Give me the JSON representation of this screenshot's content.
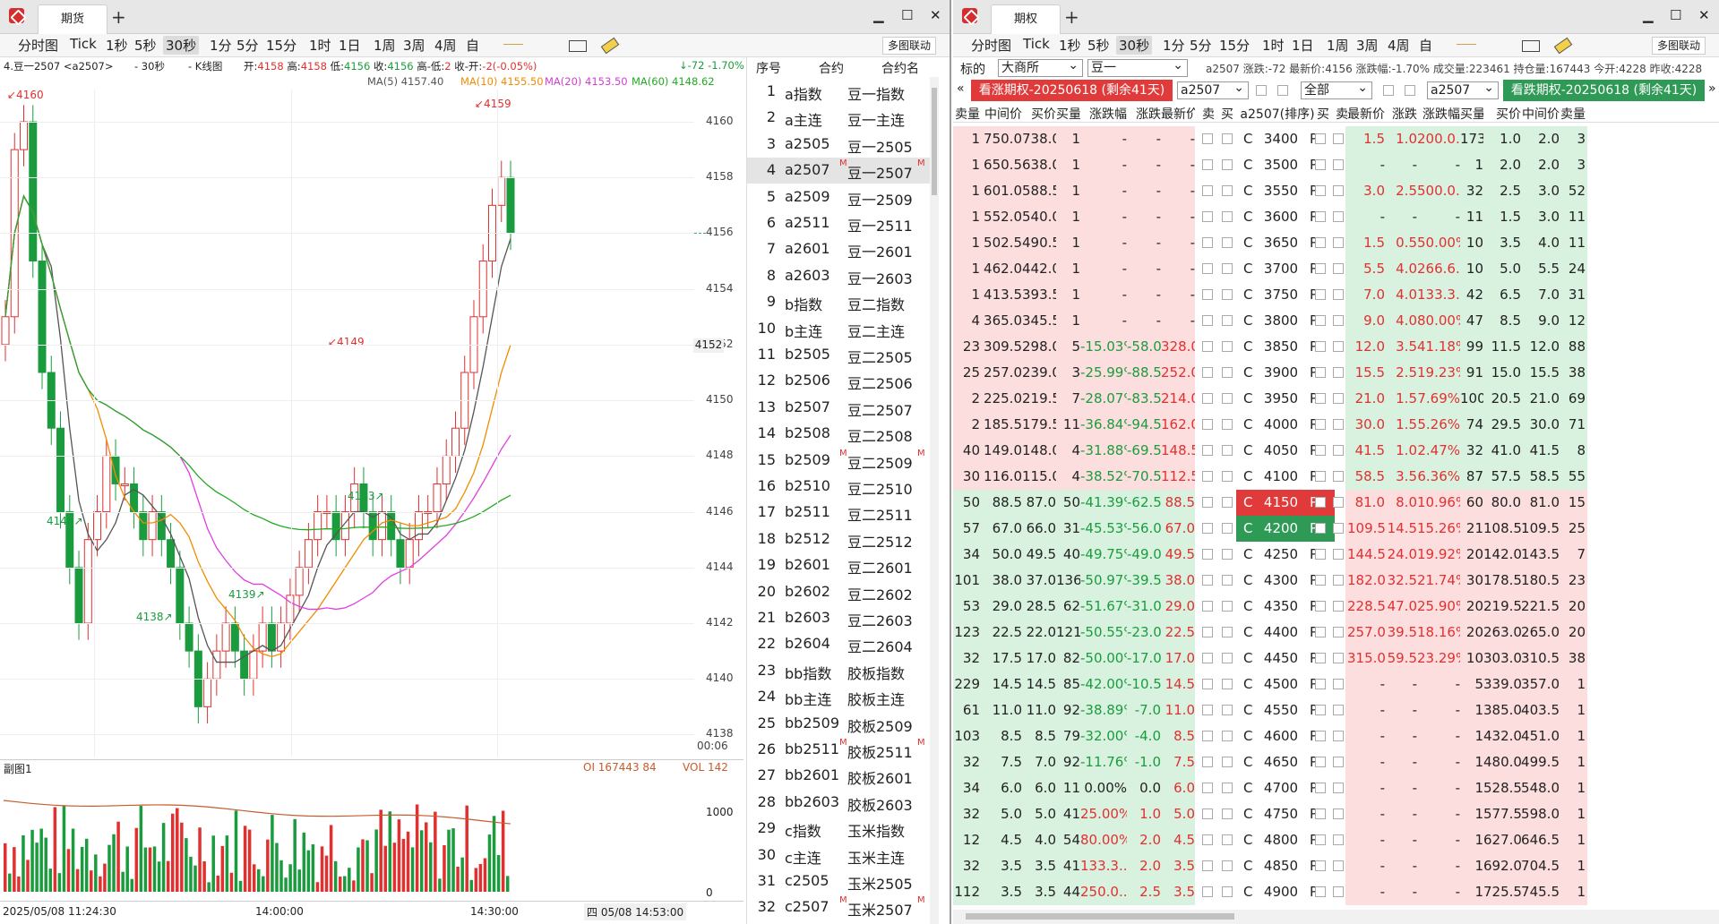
{
  "left_window": {
    "tab_label": "期货",
    "toolbar": {
      "items": [
        "分时图",
        "Tick",
        "1秒",
        "5秒",
        "30秒",
        "1分",
        "5分",
        "15分",
        "1时",
        "1日",
        "1周",
        "3周",
        "4周",
        "自"
      ],
      "selected": "30秒",
      "linked_label": "多图联动"
    },
    "chart_info": {
      "symbol": "4.豆一2507 <a2507>",
      "period": "- 30秒",
      "type": "- K线图",
      "open_label": "开:",
      "open": "4158",
      "high_label": "高:",
      "high": "4158",
      "low_label": "低:",
      "low": "4156",
      "close_label": "收:",
      "close": "4156",
      "hl_label": "高-低:",
      "hl": "2",
      "co_label": "收-开:",
      "co": "-2(-0.05%)",
      "change": "↓-72 -1.70%"
    },
    "ma": {
      "ma5": "MA(5) 4157.40",
      "ma10": "MA(10) 4155.50",
      "ma20": "MA(20) 4153.50",
      "ma60": "MA(60) 4148.62"
    },
    "price_axis": [
      "4160",
      "4158",
      "4156",
      "4154",
      "4152",
      "4150",
      "4148",
      "4146",
      "4144",
      "4142",
      "4140",
      "4138"
    ],
    "last_price": "4152",
    "time_label": "00:06",
    "annotations": [
      "4160",
      "4159",
      "4149",
      "4143",
      "4142",
      "4139",
      "4138"
    ],
    "sub_chart": {
      "title": "副图1",
      "oi": "OI 167443 84",
      "vol": "VOL 142",
      "axis": [
        "1000",
        "0"
      ]
    },
    "time_axis": [
      "2025/05/08 11:24:30",
      "14:00:00",
      "14:30:00",
      "四 05/08 14:53:00"
    ]
  },
  "chart_data": {
    "type": "candlestick",
    "title": "",
    "xlabel": "",
    "ylabel": "",
    "ylim": [
      4137.5,
      4160.9
    ],
    "ma_series": [
      {
        "name": "MA(5)",
        "color": "#555555"
      },
      {
        "name": "MA(10)",
        "color": "#f08c00"
      },
      {
        "name": "MA(20)",
        "color": "#e040e0"
      },
      {
        "name": "MA(60)",
        "color": "#22aa22"
      }
    ],
    "closes": [
      4153,
      4159,
      4160,
      4155,
      4151,
      4149,
      4146,
      4144,
      4142,
      4145,
      4146,
      4148,
      4147,
      4147,
      4146,
      4145,
      4146,
      4145,
      4144,
      4142,
      4141,
      4139,
      4140,
      4141,
      4142,
      4141,
      4140,
      4141,
      4142,
      4141,
      4142,
      4143,
      4144,
      4145,
      4146,
      4146,
      4145,
      4146,
      4147,
      4146,
      4145,
      4146,
      4145,
      4144,
      4145,
      4146,
      4146,
      4147,
      4148,
      4149,
      4151,
      4153,
      4155,
      4157,
      4158,
      4156
    ]
  },
  "list": {
    "headers": [
      "序号",
      "合约",
      "合约名"
    ],
    "rows": [
      [
        "1",
        "a指数",
        "豆一指数",
        ""
      ],
      [
        "2",
        "a主连",
        "豆一主连",
        ""
      ],
      [
        "3",
        "a2505",
        "豆一2505",
        ""
      ],
      [
        "4",
        "a2507",
        "豆一2507",
        "M"
      ],
      [
        "5",
        "a2509",
        "豆一2509",
        ""
      ],
      [
        "6",
        "a2511",
        "豆一2511",
        ""
      ],
      [
        "7",
        "a2601",
        "豆一2601",
        ""
      ],
      [
        "8",
        "a2603",
        "豆一2603",
        ""
      ],
      [
        "9",
        "b指数",
        "豆二指数",
        ""
      ],
      [
        "10",
        "b主连",
        "豆二主连",
        ""
      ],
      [
        "11",
        "b2505",
        "豆二2505",
        ""
      ],
      [
        "12",
        "b2506",
        "豆二2506",
        ""
      ],
      [
        "13",
        "b2507",
        "豆二2507",
        ""
      ],
      [
        "14",
        "b2508",
        "豆二2508",
        ""
      ],
      [
        "15",
        "b2509",
        "豆二2509",
        "M"
      ],
      [
        "16",
        "b2510",
        "豆二2510",
        ""
      ],
      [
        "17",
        "b2511",
        "豆二2511",
        ""
      ],
      [
        "18",
        "b2512",
        "豆二2512",
        ""
      ],
      [
        "19",
        "b2601",
        "豆二2601",
        ""
      ],
      [
        "20",
        "b2602",
        "豆二2602",
        ""
      ],
      [
        "21",
        "b2603",
        "豆二2603",
        ""
      ],
      [
        "22",
        "b2604",
        "豆二2604",
        ""
      ],
      [
        "23",
        "bb指数",
        "胶板指数",
        ""
      ],
      [
        "24",
        "bb主连",
        "胶板主连",
        ""
      ],
      [
        "25",
        "bb2509",
        "胶板2509",
        ""
      ],
      [
        "26",
        "bb2511",
        "胶板2511",
        "M"
      ],
      [
        "27",
        "bb2601",
        "胶板2601",
        ""
      ],
      [
        "28",
        "bb2603",
        "胶板2603",
        ""
      ],
      [
        "29",
        "c指数",
        "玉米指数",
        ""
      ],
      [
        "30",
        "c主连",
        "玉米主连",
        ""
      ],
      [
        "31",
        "c2505",
        "玉米2505",
        ""
      ],
      [
        "32",
        "c2507",
        "玉米2507",
        "M"
      ]
    ]
  },
  "right_window": {
    "tab_label": "期权",
    "toolbar": {
      "items": [
        "分时图",
        "Tick",
        "1秒",
        "5秒",
        "30秒",
        "1分",
        "5分",
        "15分",
        "1时",
        "1日",
        "1周",
        "3周",
        "4周",
        "自"
      ],
      "selected": "30秒",
      "linked_label": "多图联动"
    },
    "filter": {
      "label": "标的",
      "exchange": "大商所",
      "product": "豆一",
      "info": "a2507 涨跌:-72 最新价:4156 涨跌幅:-1.70% 成交量:223461 持仓量:167443 今开:4228 昨收:4228"
    },
    "call_banner": "看涨期权-20250618 (剩余41天)",
    "put_banner": "看跌期权-20250618 (剩余41天)",
    "contract_left": "a2507",
    "contract_right": "a2507",
    "all_label": "全部",
    "headers": [
      "卖量",
      "中间价",
      "买价",
      "买量",
      "涨跌幅",
      "涨跌",
      "最新价",
      "卖",
      "买",
      "a2507(排序)",
      "买",
      "卖",
      "最新价",
      "涨跌",
      "涨跌幅",
      "买量",
      "买价",
      "中间价",
      "卖量"
    ],
    "rows": [
      [
        "1",
        "750.0",
        "738.0",
        "1",
        "-",
        "-",
        "-",
        "3400",
        "1.5",
        "1.0",
        "200.0...",
        "173",
        "1.0",
        "2.0",
        "3"
      ],
      [
        "1",
        "650.5",
        "638.0",
        "1",
        "-",
        "-",
        "-",
        "3500",
        "-",
        "-",
        "-",
        "1",
        "2.0",
        "2.0",
        "3"
      ],
      [
        "1",
        "601.0",
        "588.5",
        "1",
        "-",
        "-",
        "-",
        "3550",
        "3.0",
        "2.5",
        "500.0...",
        "32",
        "2.5",
        "3.0",
        "52"
      ],
      [
        "1",
        "552.0",
        "540.0",
        "1",
        "-",
        "-",
        "-",
        "3600",
        "-",
        "-",
        "-",
        "11",
        "1.5",
        "3.0",
        "11"
      ],
      [
        "1",
        "502.5",
        "490.5",
        "1",
        "-",
        "-",
        "-",
        "3650",
        "1.5",
        "0.5",
        "50.00%",
        "10",
        "3.5",
        "4.0",
        "11"
      ],
      [
        "1",
        "462.0",
        "442.0",
        "1",
        "-",
        "-",
        "-",
        "3700",
        "5.5",
        "4.0",
        "266.6...",
        "10",
        "5.0",
        "5.5",
        "24"
      ],
      [
        "1",
        "413.5",
        "393.5",
        "1",
        "-",
        "-",
        "-",
        "3750",
        "7.0",
        "4.0",
        "133.3...",
        "42",
        "6.5",
        "7.0",
        "31"
      ],
      [
        "4",
        "365.0",
        "345.5",
        "1",
        "-",
        "-",
        "-",
        "3800",
        "9.0",
        "4.0",
        "80.00%",
        "47",
        "8.5",
        "9.0",
        "12"
      ],
      [
        "23",
        "309.5",
        "298.0",
        "5",
        "-15.03%",
        "-58.0",
        "328.0",
        "3850",
        "12.0",
        "3.5",
        "41.18%",
        "99",
        "11.5",
        "12.0",
        "88"
      ],
      [
        "25",
        "257.0",
        "239.0",
        "3",
        "-25.99%",
        "-88.5",
        "252.0",
        "3900",
        "15.5",
        "2.5",
        "19.23%",
        "91",
        "15.0",
        "15.5",
        "38"
      ],
      [
        "2",
        "225.0",
        "219.5",
        "7",
        "-28.07%",
        "-83.5",
        "214.0",
        "3950",
        "21.0",
        "1.5",
        "7.69%",
        "100",
        "20.5",
        "21.0",
        "69"
      ],
      [
        "2",
        "185.5",
        "179.5",
        "11",
        "-36.84%",
        "-94.5",
        "162.0",
        "4000",
        "30.0",
        "1.5",
        "5.26%",
        "74",
        "29.5",
        "30.0",
        "71"
      ],
      [
        "40",
        "149.0",
        "148.0",
        "4",
        "-31.88%",
        "-69.5",
        "148.5",
        "4050",
        "41.5",
        "1.0",
        "2.47%",
        "32",
        "41.0",
        "41.5",
        "8"
      ],
      [
        "30",
        "116.0",
        "115.0",
        "4",
        "-38.52%",
        "-70.5",
        "112.5",
        "4100",
        "58.5",
        "3.5",
        "6.36%",
        "87",
        "57.5",
        "58.5",
        "55"
      ],
      [
        "50",
        "88.5",
        "87.0",
        "50",
        "-41.39%",
        "-62.5",
        "88.5",
        "4150",
        "81.0",
        "8.0",
        "10.96%",
        "60",
        "80.0",
        "81.0",
        "15"
      ],
      [
        "57",
        "67.0",
        "66.0",
        "31",
        "-45.53%",
        "-56.0",
        "67.0",
        "4200",
        "109.5",
        "14.5",
        "15.26%",
        "21",
        "108.5",
        "109.5",
        "25"
      ],
      [
        "34",
        "50.0",
        "49.5",
        "40",
        "-49.75%",
        "-49.0",
        "49.5",
        "4250",
        "144.5",
        "24.0",
        "19.92%",
        "20",
        "142.0",
        "143.5",
        "7"
      ],
      [
        "101",
        "38.0",
        "37.0",
        "136",
        "-50.97%",
        "-39.5",
        "38.0",
        "4300",
        "182.0",
        "32.5",
        "21.74%",
        "30",
        "178.5",
        "180.5",
        "23"
      ],
      [
        "53",
        "29.0",
        "28.5",
        "62",
        "-51.67%",
        "-31.0",
        "29.0",
        "4350",
        "228.5",
        "47.0",
        "25.90%",
        "20",
        "219.5",
        "221.5",
        "20"
      ],
      [
        "123",
        "22.5",
        "22.0",
        "121",
        "-50.55%",
        "-23.0",
        "22.5",
        "4400",
        "257.0",
        "39.5",
        "18.16%",
        "20",
        "263.0",
        "265.0",
        "20"
      ],
      [
        "32",
        "17.5",
        "17.0",
        "82",
        "-50.00%",
        "-17.0",
        "17.0",
        "4450",
        "315.0",
        "59.5",
        "23.29%",
        "10",
        "303.0",
        "310.5",
        "38"
      ],
      [
        "229",
        "14.5",
        "14.5",
        "85",
        "-42.00%",
        "-10.5",
        "14.5",
        "4500",
        "-",
        "-",
        "-",
        "5",
        "339.0",
        "357.0",
        "1"
      ],
      [
        "61",
        "11.0",
        "11.0",
        "92",
        "-38.89%",
        "-7.0",
        "11.0",
        "4550",
        "-",
        "-",
        "-",
        "1",
        "385.0",
        "403.5",
        "1"
      ],
      [
        "103",
        "8.5",
        "8.5",
        "79",
        "-32.00%",
        "-4.0",
        "8.5",
        "4600",
        "-",
        "-",
        "-",
        "1",
        "432.0",
        "451.0",
        "1"
      ],
      [
        "32",
        "7.5",
        "7.0",
        "92",
        "-11.76%",
        "-1.0",
        "7.5",
        "4650",
        "-",
        "-",
        "-",
        "1",
        "480.0",
        "499.5",
        "1"
      ],
      [
        "34",
        "6.0",
        "6.0",
        "11",
        "0.00%",
        "0.0",
        "6.0",
        "4700",
        "-",
        "-",
        "-",
        "1",
        "528.5",
        "548.0",
        "1"
      ],
      [
        "32",
        "5.0",
        "5.0",
        "41",
        "25.00%",
        "1.0",
        "5.0",
        "4750",
        "-",
        "-",
        "-",
        "1",
        "577.5",
        "598.0",
        "1"
      ],
      [
        "12",
        "4.5",
        "4.0",
        "54",
        "80.00%",
        "2.0",
        "4.5",
        "4800",
        "-",
        "-",
        "-",
        "1",
        "627.0",
        "646.5",
        "1"
      ],
      [
        "32",
        "3.5",
        "3.5",
        "41",
        "133.3...",
        "2.0",
        "3.5",
        "4850",
        "-",
        "-",
        "-",
        "1",
        "692.0",
        "704.5",
        "1"
      ],
      [
        "112",
        "3.5",
        "3.5",
        "44",
        "250.0...",
        "2.5",
        "3.5",
        "4900",
        "-",
        "-",
        "-",
        "1",
        "725.5",
        "745.5",
        "1"
      ]
    ]
  },
  "colors": {
    "up": "#e03030",
    "down": "#1a9c3e",
    "call_bg": "#fddede",
    "put_bg": "#d9f2df",
    "atm_call": "#e03a3a",
    "atm_put": "#2e9a55"
  }
}
